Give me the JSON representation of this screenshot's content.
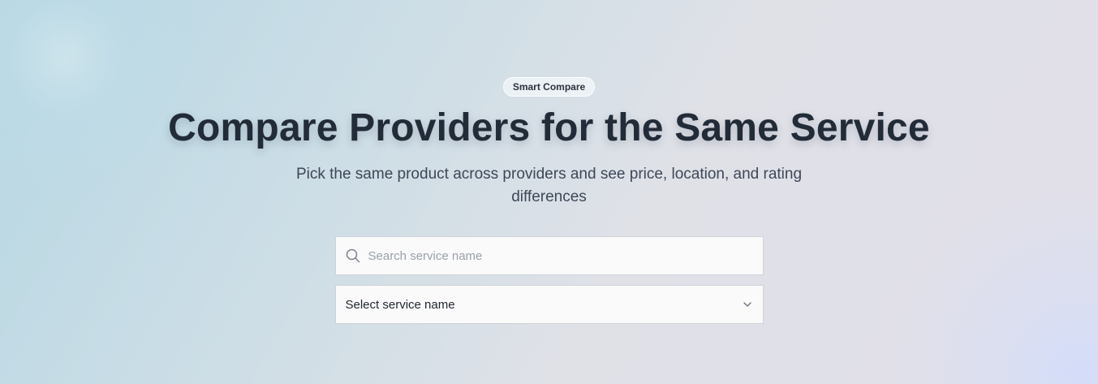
{
  "hero": {
    "badge": "Smart Compare",
    "title": "Compare Providers for the Same Service",
    "subtitle": "Pick the same product across providers and see price, location, and rating differences"
  },
  "search": {
    "placeholder": "Search service name",
    "value": "",
    "icon": "search-icon"
  },
  "service_select": {
    "selected": "Select service name",
    "icon": "chevron-down-icon"
  },
  "colors": {
    "title": "#222b38",
    "subtitle": "#3e4757",
    "badge_bg": "#f0f4f7",
    "input_border": "#cfd3d9"
  }
}
